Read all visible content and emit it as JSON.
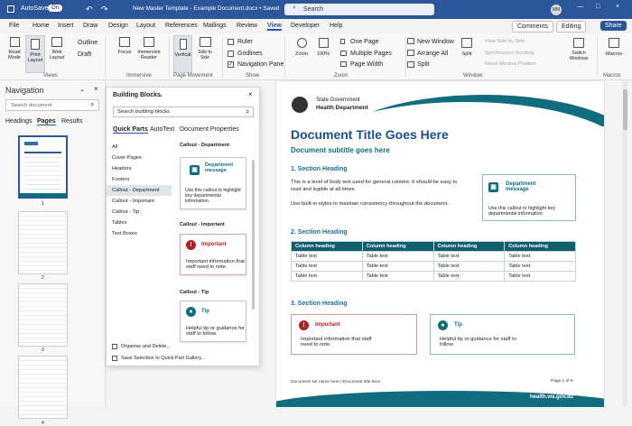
{
  "title_bar": {
    "autosave": "AutoSave",
    "toggle": "On",
    "doc_title": "New Master Template - Example Document.docx • Saved",
    "search": "Search",
    "user": "MM"
  },
  "menu": [
    "File",
    "Home",
    "Insert",
    "Draw",
    "Design",
    "Layout",
    "References",
    "Mailings",
    "Review",
    "View",
    "Developer",
    "Help"
  ],
  "actions": {
    "comments": "Comments",
    "editing": "Editing",
    "share": "Share"
  },
  "ribbon": {
    "views": [
      "Read Mode",
      "Print Layout",
      "Web Layout"
    ],
    "views_small": [
      "Outline",
      "Draft"
    ],
    "views_label": "Views",
    "immersive": [
      "Focus",
      "Immersive Reader"
    ],
    "immersive_label": "Immersive",
    "page_movement": [
      "Vertical",
      "Side to Side"
    ],
    "page_movement_label": "Page Movement",
    "show": [
      "Ruler",
      "Gridlines",
      "Navigation Pane"
    ],
    "show_label": "Show",
    "zoom": [
      "Zoom",
      "100%"
    ],
    "zoom_small": [
      "One Page",
      "Multiple Pages",
      "Page Width"
    ],
    "zoom_label": "Zoom",
    "window": [
      "New Window",
      "Arrange All",
      "Split"
    ],
    "window_split": "Split",
    "window_small": [
      "View Side by Side",
      "Synchronous Scrolling",
      "Reset Window Position"
    ],
    "window_label": "Window",
    "switch": "Switch Windows",
    "macros": "Macros",
    "macros_label": "Macros"
  },
  "navigation": {
    "title": "Navigation",
    "search_placeholder": "Search document",
    "tabs": [
      "Headings",
      "Pages",
      "Results"
    ],
    "page_numbers": [
      "1",
      "2",
      "3",
      "4"
    ]
  },
  "building_blocks": {
    "title": "Building Blocks",
    "search_placeholder": "Search building blocks",
    "tabs": [
      "Quick Parts",
      "AutoText",
      "Document Properties"
    ],
    "categories": [
      "All",
      "Cover Pages",
      "Headers",
      "Footers",
      "Callout - Department",
      "Callout - Important",
      "Callout - Tip",
      "Tables",
      "Text Boxes"
    ],
    "sections": [
      {
        "heading": "Callout - Department",
        "title": "Department message",
        "body": "Use this callout to highlight key departmental information."
      },
      {
        "heading": "Callout - Important",
        "title": "Important",
        "body": "Important information that staff need to note."
      },
      {
        "heading": "Callout - Tip",
        "title": "Tip",
        "body": "Helpful tip or guidance for staff to follow."
      }
    ],
    "footer_actions": [
      "Organise and Delete...",
      "Save Selection to Quick Part Gallery..."
    ]
  },
  "document": {
    "org1": "State Government",
    "org2": "Health Department",
    "title": "Document Title Goes Here",
    "subtitle": "Document subtitle goes here",
    "section1": "1.  Section Heading",
    "body1": "This is a level of body text used for general content. It should be easy to read and legible at all times.",
    "body2": "Use built-in styles to maintain consistency throughout the document.",
    "callout_title": "Department message",
    "callout_body": "Use this callout to highlight key departmental information.",
    "section2": "2.  Section Heading",
    "table_headers": [
      "Column heading",
      "Column heading",
      "Column heading",
      "Column heading"
    ],
    "table_rows": [
      [
        "Table text",
        "Table text",
        "Table text",
        "Table text"
      ],
      [
        "Table text",
        "Table text",
        "Table text",
        "Table text"
      ],
      [
        "Table text",
        "Table text",
        "Table text",
        "Table text"
      ]
    ],
    "section3": "3.  Section Heading",
    "important_title": "Important",
    "important_body": "Important information that staff need to note.",
    "tip_title": "Tip",
    "tip_body": "Helpful tip or guidance for staff to follow.",
    "footer_left": "Document set name here  |  Document title here",
    "footer_page": "Page 1 of 6",
    "footer_url": "health.wa.gov.au"
  },
  "colors": {
    "brand": "#2b579a",
    "teal": "#0f6d7d",
    "red": "#b41f24"
  }
}
